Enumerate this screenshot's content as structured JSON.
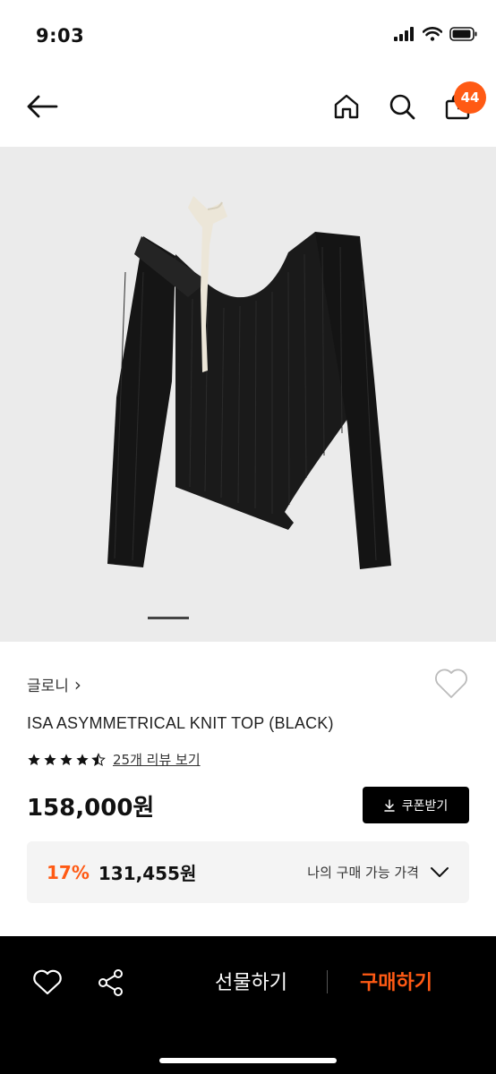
{
  "status_bar": {
    "time": "9:03",
    "icons": [
      "signal-icon",
      "wifi-icon",
      "battery-icon"
    ]
  },
  "header": {
    "icons": [
      "back-arrow-icon",
      "home-icon",
      "search-icon",
      "cart-icon"
    ],
    "cart_count": "44"
  },
  "gallery": {
    "image": "black asymmetrical ribbed knit top with cream ribbon tie",
    "current_index": 1
  },
  "product": {
    "brand": "글로니",
    "brand_chevron": "›",
    "name": "ISA ASYMMETRICAL KNIT TOP (BLACK)",
    "rating": 4.5,
    "review_link": "25개 리뷰 보기",
    "price": "158,000원",
    "coupon_button": "쿠폰받기",
    "discount": {
      "rate": "17%",
      "price": "131,455원",
      "label": "나의 구매 가능 가격"
    }
  },
  "bottom_bar": {
    "icons": [
      "heart-icon",
      "share-icon"
    ],
    "gift_label": "선물하기",
    "buy_label": "구매하기"
  },
  "colors": {
    "accent": "#ff5a14",
    "bottom_bar": "#000000",
    "gallery_bg": "#ebebeb",
    "discount_bg": "#f4f4f4"
  }
}
